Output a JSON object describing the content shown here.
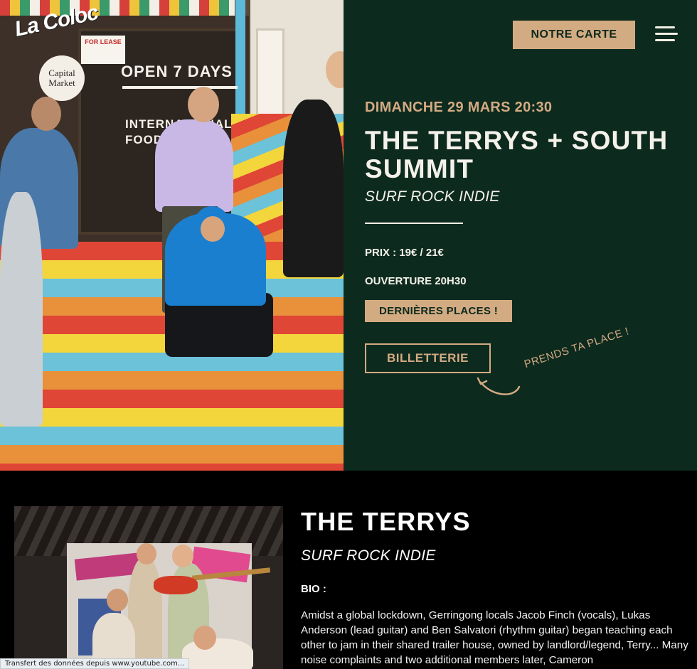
{
  "header": {
    "logo_text": "La Coloc",
    "menu_button_label": "NOTRE CARTE"
  },
  "hero_photo": {
    "signs": {
      "open": "OPEN 7 DAYS",
      "food": "INTERNATIONAL FOOD MARKET",
      "lease": "FOR LEASE",
      "market": "Capital Market"
    }
  },
  "event": {
    "date": "DIMANCHE 29 MARS 20:30",
    "title": "THE TERRYS + SOUTH SUMMIT",
    "genre": "SURF ROCK INDIE",
    "prix": "PRIX : 19€ / 21€",
    "ouverture": "OUVERTURE 20H30",
    "badge": "DERNIÈRES PLACES !",
    "ticket_button": "BILLETTERIE",
    "ticket_hint": "PRENDS TA PLACE !"
  },
  "artist": {
    "name": "THE TERRYS",
    "genre": "SURF ROCK INDIE",
    "bio_label": "BIO :",
    "bio_text": "Amidst a global lockdown, Gerringong locals Jacob Finch (vocals), Lukas Anderson (lead guitar) and Ben Salvatori (rhythm guitar) began teaching each other to jam in their shared trailer house, owned by landlord/legend, Terry... Many noise complaints and two additional members later, Cameron"
  },
  "browser_status": "Transfert des données depuis www.youtube.com...",
  "colors": {
    "panel_bg": "#0d2a1e",
    "accent": "#d3ab82",
    "text_light": "#f4f1ea",
    "page_bg": "#000000"
  }
}
